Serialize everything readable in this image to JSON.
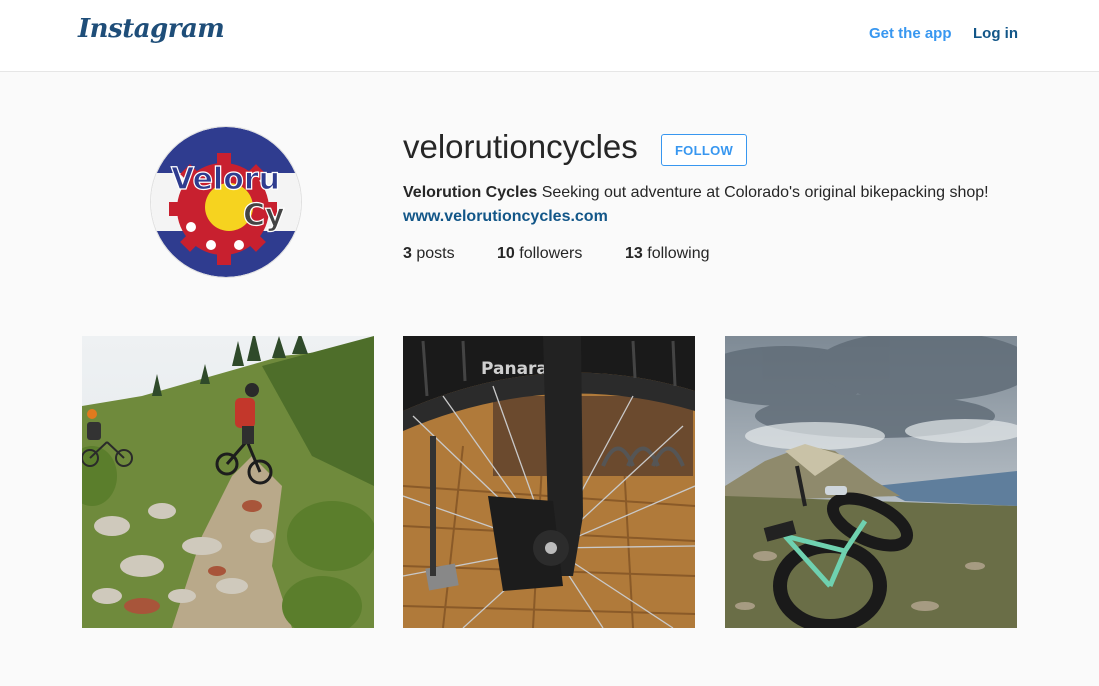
{
  "header": {
    "logo_text": "Instagram",
    "get_app_label": "Get the app",
    "login_label": "Log in"
  },
  "profile": {
    "username": "velorutioncycles",
    "follow_label": "FOLLOW",
    "full_name": "Velorution Cycles",
    "bio": " Seeking out adventure at Colorado's original bikepacking shop!",
    "website": "www.velorutioncycles.com",
    "avatar_text_1": "Veloru",
    "avatar_text_2": "Cy",
    "stats": {
      "posts_count": "3",
      "posts_label": " posts",
      "followers_count": "10",
      "followers_label": " followers",
      "following_count": "13",
      "following_label": " following"
    }
  },
  "posts": [
    {
      "subject": "mountain-bikers-on-rocky-trail"
    },
    {
      "subject": "fat-bike-wheel-closeup",
      "tire_text": "Panara"
    },
    {
      "subject": "fat-bike-on-mountain-summit"
    }
  ],
  "colors": {
    "link_blue": "#3897f0",
    "dark_blue": "#125688",
    "text": "#262626",
    "background": "#fafafa"
  }
}
